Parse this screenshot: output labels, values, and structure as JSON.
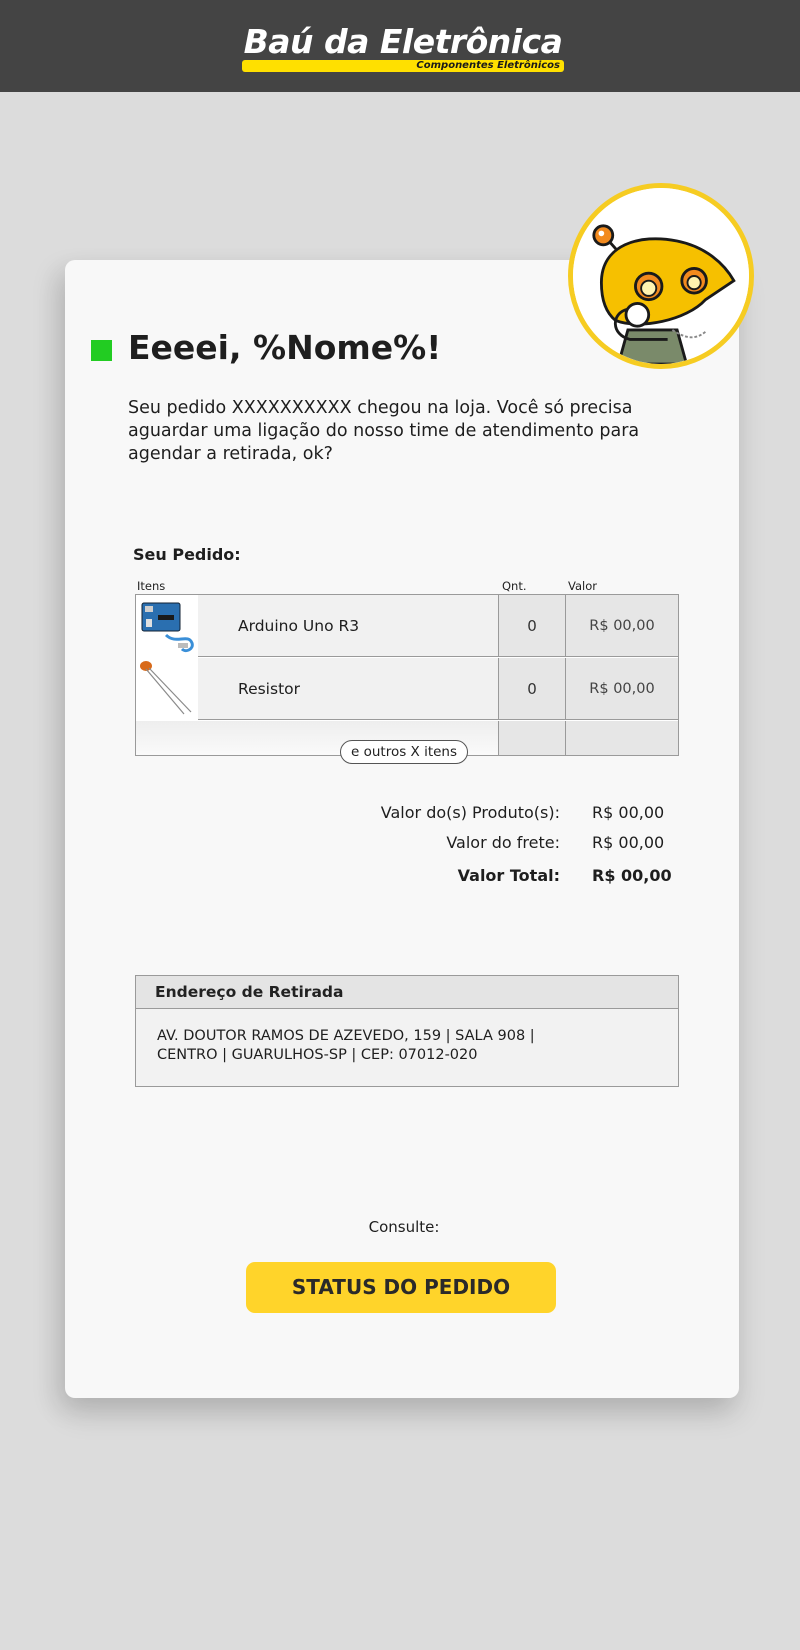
{
  "header": {
    "brand_name": "Baú da Eletrônica",
    "brand_tagline": "Componentes Eletrônicos"
  },
  "message": {
    "greeting": "Eeeei, %Nome%!",
    "intro": "Seu pedido XXXXXXXXXX chegou na loja. Você só precisa aguardar uma ligação do nosso time de atendimento para agendar a retirada, ok?"
  },
  "order": {
    "title": "Seu Pedido:",
    "columns": {
      "items": "Itens",
      "qty": "Qnt.",
      "value": "Valor"
    },
    "items": [
      {
        "name": "Arduino Uno R3",
        "qty": "0",
        "value": "R$ 00,00",
        "icon": "arduino-board-thumbnail"
      },
      {
        "name": "Resistor",
        "qty": "0",
        "value": "R$ 00,00",
        "icon": "capacitor-thumbnail"
      }
    ],
    "more_items": "e outros X itens"
  },
  "summary": {
    "products_label": "Valor do(s) Produto(s):",
    "products_value": "R$ 00,00",
    "shipping_label": "Valor do frete:",
    "shipping_value": "R$ 00,00",
    "total_label": "Valor Total:",
    "total_value": "R$ 00,00"
  },
  "pickup": {
    "title": "Endereço de Retirada",
    "line1": "AV. DOUTOR RAMOS DE AZEVEDO, 159 | SALA 908 |",
    "line2": "CENTRO | GUARULHOS-SP | CEP: 07012-020"
  },
  "cta": {
    "prompt": "Consulte:",
    "button_label": "STATUS DO PEDIDO"
  },
  "colors": {
    "header_bg": "#444444",
    "accent_yellow": "#ffd42a",
    "bullet_green": "#22cc22",
    "page_bg": "#dcdcdc",
    "card_bg": "#f8f8f8"
  }
}
